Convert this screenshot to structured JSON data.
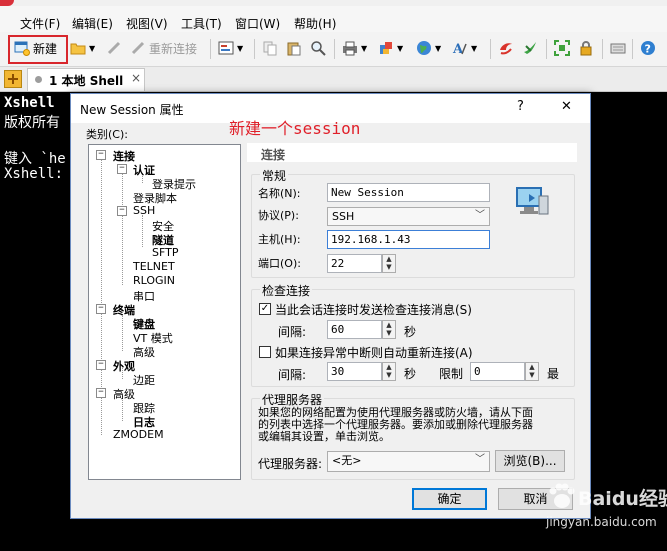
{
  "menu": [
    "文件(F)",
    "编辑(E)",
    "视图(V)",
    "工具(T)",
    "窗口(W)",
    "帮助(H)"
  ],
  "toolbar": {
    "new_label": "新建",
    "reconnect_label": "重新连接"
  },
  "tab": {
    "label": "1 本地 Shell",
    "close": "×"
  },
  "terminal": {
    "lines": [
      "Xshell",
      "版权所有",
      "",
      "键入 `he",
      "Xshell:"
    ]
  },
  "dialog": {
    "title": "New Session 属性",
    "help": "?",
    "close": "✕",
    "category_label": "类别(C):",
    "annotation": "新建一个session",
    "tree": [
      "连接",
      "认证",
      "登录提示",
      "登录脚本",
      "SSH",
      "安全",
      "隧道",
      "SFTP",
      "TELNET",
      "RLOGIN",
      "串口",
      "终端",
      "键盘",
      "VT 模式",
      "高级",
      "外观",
      "边距",
      "高级",
      "跟踪",
      "日志",
      "ZMODEM"
    ],
    "section_header": "连接",
    "general_group": "常规",
    "name_label": "名称(N):",
    "name_value": "New Session",
    "protocol_label": "协议(P):",
    "protocol_value": "SSH",
    "host_label": "主机(H):",
    "host_value": "192.168.1.43",
    "port_label": "端口(O):",
    "port_value": "22",
    "check_group": "检查连接",
    "keepalive_label": "当此会话连接时发送检查连接消息(S)",
    "keepalive_checked": true,
    "interval_label": "间隔:",
    "interval_value": "60",
    "seconds_label": "秒",
    "reconnect_label": "如果连接异常中断则自动重新连接(A)",
    "reconnect_checked": false,
    "reconnect_interval_label": "间隔:",
    "reconnect_interval_value": "30",
    "reconnect_seconds_label": "秒",
    "limit_label": "限制",
    "limit_value": "0",
    "limit_unit": "最",
    "proxy_group": "代理服务器",
    "proxy_desc_1": "如果您的网络配置为使用代理服务器或防火墙，请从下面",
    "proxy_desc_2": "的列表中选择一个代理服务器。要添加或删除代理服务器",
    "proxy_desc_3": "或编辑其设置，单击浏览。",
    "proxy_label": "代理服务器:",
    "proxy_value": "<无>",
    "browse_label": "浏览(B)...",
    "ok_label": "确定",
    "cancel_label": "取消"
  },
  "watermark": {
    "brand": "Baidu经验",
    "url": "jingyan.baidu.com"
  },
  "colors": {
    "annotation": "#e0202a",
    "highlight": "#d8262c",
    "terminal_bg": "#000000"
  }
}
